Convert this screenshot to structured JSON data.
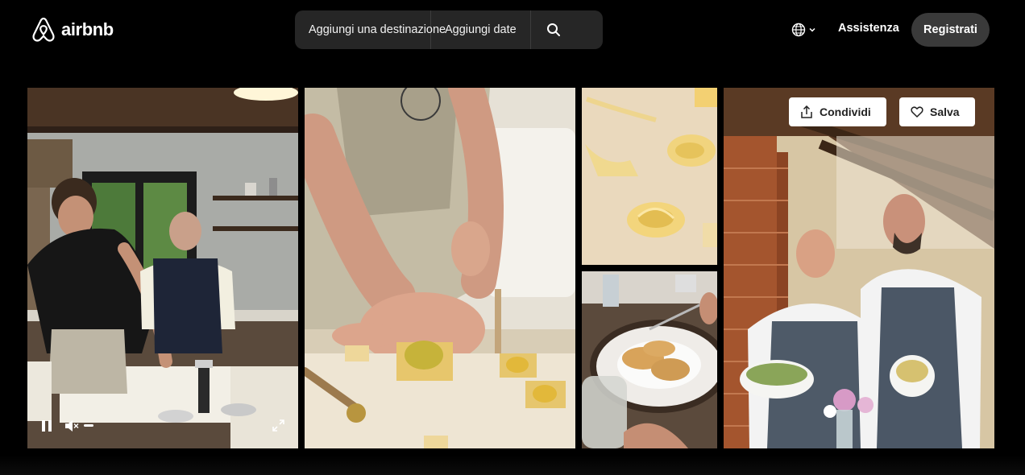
{
  "header": {
    "logo_text": "airbnb",
    "search": {
      "destination_label": "Aggiungi una destinazione",
      "dates_label": "Aggiungi date",
      "search_icon": "search-icon"
    },
    "language_icon": "globe-icon",
    "help_label": "Assistenza",
    "register_label": "Registrati"
  },
  "gallery": {
    "video": {
      "controls": [
        "pause-icon",
        "muted-icon",
        "fullscreen-icon"
      ]
    },
    "actions": {
      "share_label": "Condividi",
      "save_label": "Salva"
    }
  },
  "colors": {
    "background": "#000000",
    "searchbar": "#262626",
    "register_button": "#3a3a3a",
    "action_button": "#ffffff"
  }
}
